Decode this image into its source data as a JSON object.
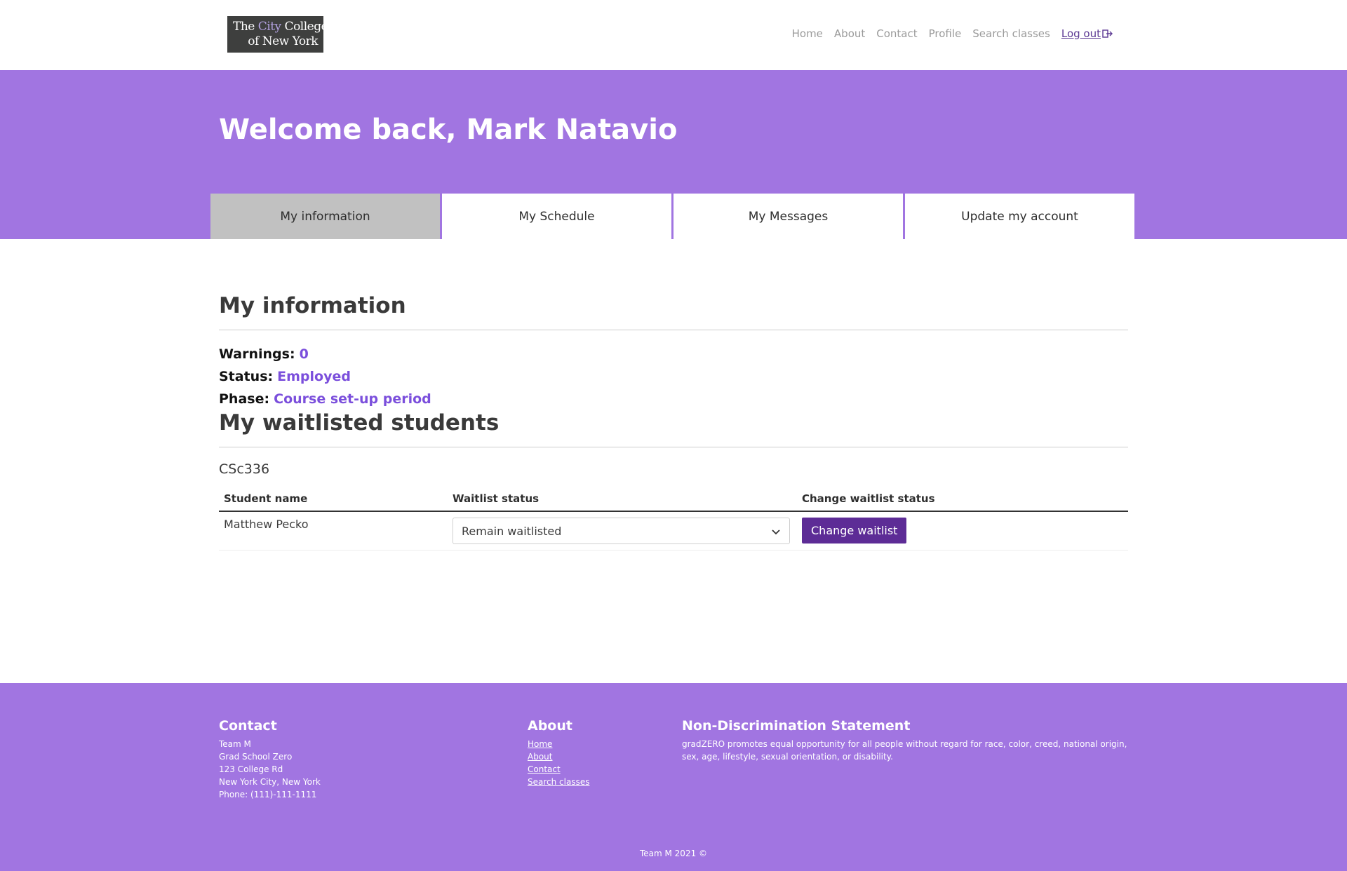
{
  "header": {
    "logo_line1_a": "The ",
    "logo_line1_b": "City",
    "logo_line1_c": " College",
    "logo_line2": "of New York",
    "nav": [
      "Home",
      "About",
      "Contact",
      "Profile",
      "Search classes"
    ],
    "logout": "Log out"
  },
  "hero": {
    "welcome": "Welcome back, Mark Natavio",
    "tabs": [
      "My information",
      "My Schedule",
      "My Messages",
      "Update my account"
    ],
    "active_tab": "My information"
  },
  "info": {
    "title": "My information",
    "warnings_label": "Warnings:",
    "warnings_value": "0",
    "status_label": "Status:",
    "status_value": "Employed",
    "phase_label": "Phase:",
    "phase_value": "Course set-up period"
  },
  "waitlist": {
    "title": "My waitlisted students",
    "course": "CSc336",
    "columns": [
      "Student name",
      "Waitlist status",
      "Change waitlist status"
    ],
    "rows": [
      {
        "student": "Matthew Pecko",
        "status": "Remain waitlisted",
        "action": "Change waitlist"
      }
    ]
  },
  "footer": {
    "contact_title": "Contact",
    "contact_lines": [
      "Team M",
      "Grad School Zero",
      "123 College Rd",
      "New York City, New York",
      "Phone: (111)-111-1111"
    ],
    "about_title": "About",
    "about_links": [
      "Home",
      "About",
      "Contact",
      "Search classes"
    ],
    "nds_title": "Non-Discrimination Statement",
    "nds_text": "gradZERO promotes equal opportunity for all people without regard for race, color, creed, national origin, sex, age, lifestyle, sexual orientation, or disability.",
    "copyright": "Team M 2021 ©"
  },
  "colors": {
    "brand_purple": "#a175e1",
    "button_purple": "#5d2c96",
    "value_purple": "#7b4fdc",
    "active_tab": "#c1c1c1"
  },
  "icons": {
    "logout": "logout-arrow-icon",
    "dropdown": "chevron-down-icon"
  }
}
